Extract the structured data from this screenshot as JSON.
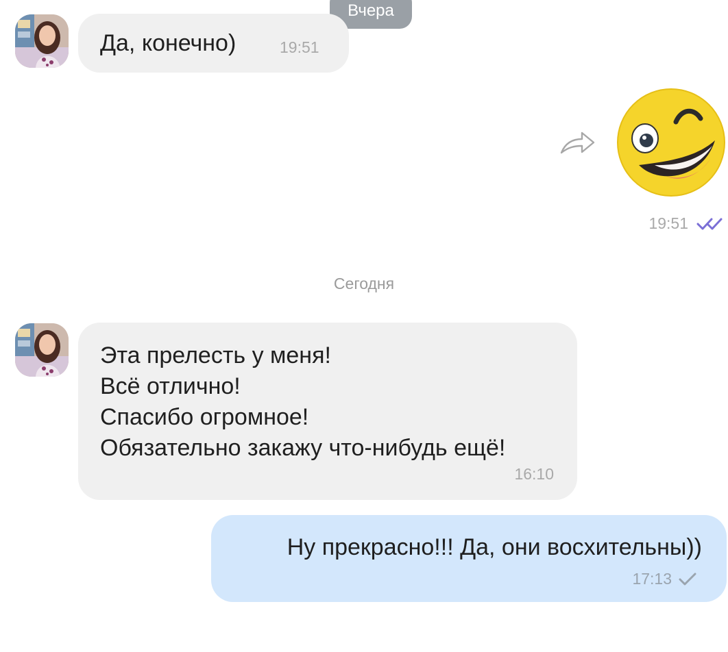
{
  "date_labels": {
    "yesterday": "Вчера",
    "today": "Сегодня"
  },
  "messages": [
    {
      "text": "Да, конечно)",
      "time": "19:51"
    },
    {
      "sticker_icon": "winking-smiley-sticker",
      "time": "19:51",
      "status_icon": "double-check-icon"
    },
    {
      "lines": [
        "Эта прелесть у меня!",
        "Всё отлично!",
        "Спасибо огромное!",
        "Обязательно закажу что-нибудь ещё!"
      ],
      "time": "16:10"
    },
    {
      "text": "Ну прекрасно!!! Да, они восхительны))",
      "time": "17:13",
      "status_icon": "single-check-icon"
    }
  ],
  "colors": {
    "incoming_bubble": "#f0f0f0",
    "outgoing_bubble": "#d3e7fc",
    "read_check": "#7b6fd6",
    "sent_check": "#9aa4ae"
  }
}
